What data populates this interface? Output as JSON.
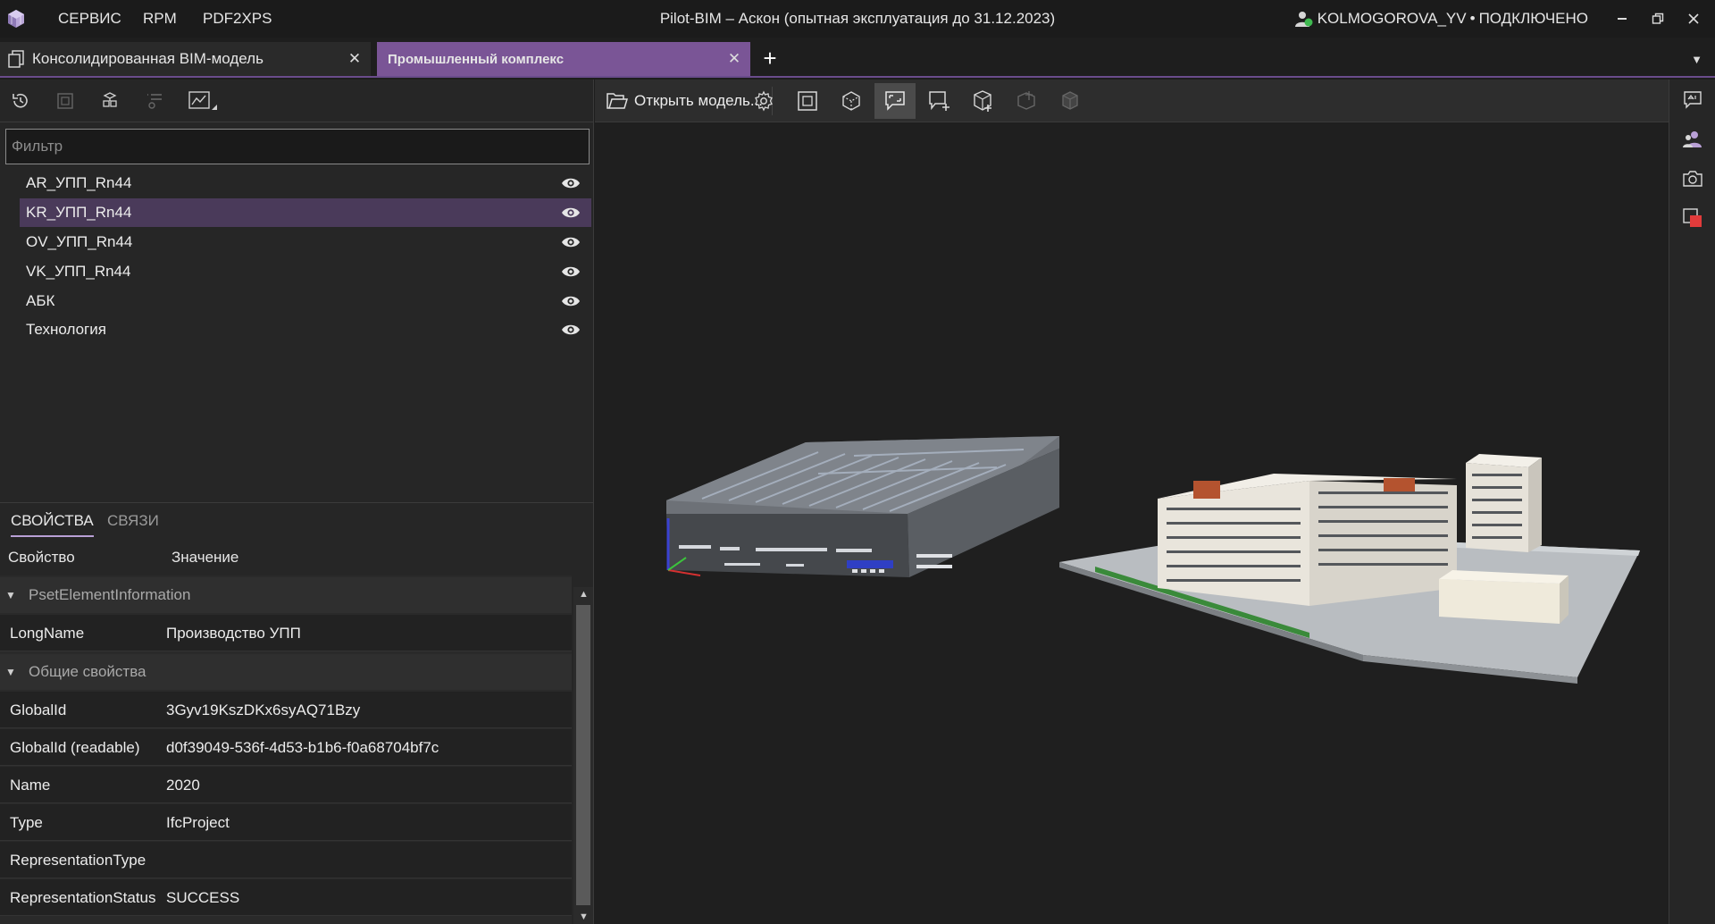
{
  "app": {
    "title": "Pilot-BIM – Аскон (опытная эксплуатация до 31.12.2023)",
    "menu": [
      "СЕРВИС",
      "RPM",
      "PDF2XPS"
    ],
    "user": "KOLMOGOROVA_YV",
    "connection_separator": "•",
    "connection": "ПОДКЛЮЧЕНО",
    "status_color": "#3fb950"
  },
  "tabs": [
    {
      "label": "Консолидированная BIM-модель",
      "active": false
    },
    {
      "label": "Промышленный комплекс",
      "active": true
    }
  ],
  "tab_add_label": "+",
  "left_panel": {
    "filter_placeholder": "Фильтр",
    "models": [
      {
        "label": "AR_УПП_Rn44",
        "visible": true,
        "selected": false
      },
      {
        "label": "KR_УПП_Rn44",
        "visible": true,
        "selected": true
      },
      {
        "label": "OV_УПП_Rn44",
        "visible": true,
        "selected": false
      },
      {
        "label": "VK_УПП_Rn44",
        "visible": true,
        "selected": false
      },
      {
        "label": "АБК",
        "visible": true,
        "selected": false
      },
      {
        "label": "Технология",
        "visible": true,
        "selected": false
      }
    ],
    "props_tabs": [
      "СВОЙСТВА",
      "СВЯЗИ"
    ],
    "grid": {
      "col_property": "Свойство",
      "col_value": "Значение",
      "groups": [
        {
          "name": "PsetElementInformation",
          "rows": [
            {
              "key": "LongName",
              "value": "Производство УПП"
            }
          ]
        },
        {
          "name": "Общие свойства",
          "rows": [
            {
              "key": "GlobalId",
              "value": "3Gyv19KszDKx6syAQ71Bzy"
            },
            {
              "key": "GlobalId (readable)",
              "value": "d0f39049-536f-4d53-b1b6-f0a68704bf7c"
            },
            {
              "key": "Name",
              "value": "2020"
            },
            {
              "key": "Type",
              "value": "IfcProject"
            },
            {
              "key": "RepresentationType",
              "value": ""
            },
            {
              "key": "RepresentationStatus",
              "value": "SUCCESS"
            }
          ]
        }
      ]
    }
  },
  "viewer": {
    "open_model_label": "Открыть модель...",
    "toolbar_icons": [
      "settings-icon",
      "fit-view-icon",
      "isometric-cube-icon",
      "comment-frame-icon",
      "add-comment-icon",
      "add-to-set-icon",
      "section-disabled-icon",
      "hide-disabled-icon"
    ],
    "right_icons": [
      "remarks-icon",
      "users-icon",
      "camera-icon",
      "snapshot-icon"
    ]
  },
  "colors": {
    "accent": "#7a5596",
    "selected_row": "#4a3a5a",
    "background": "#1e1e1e"
  }
}
